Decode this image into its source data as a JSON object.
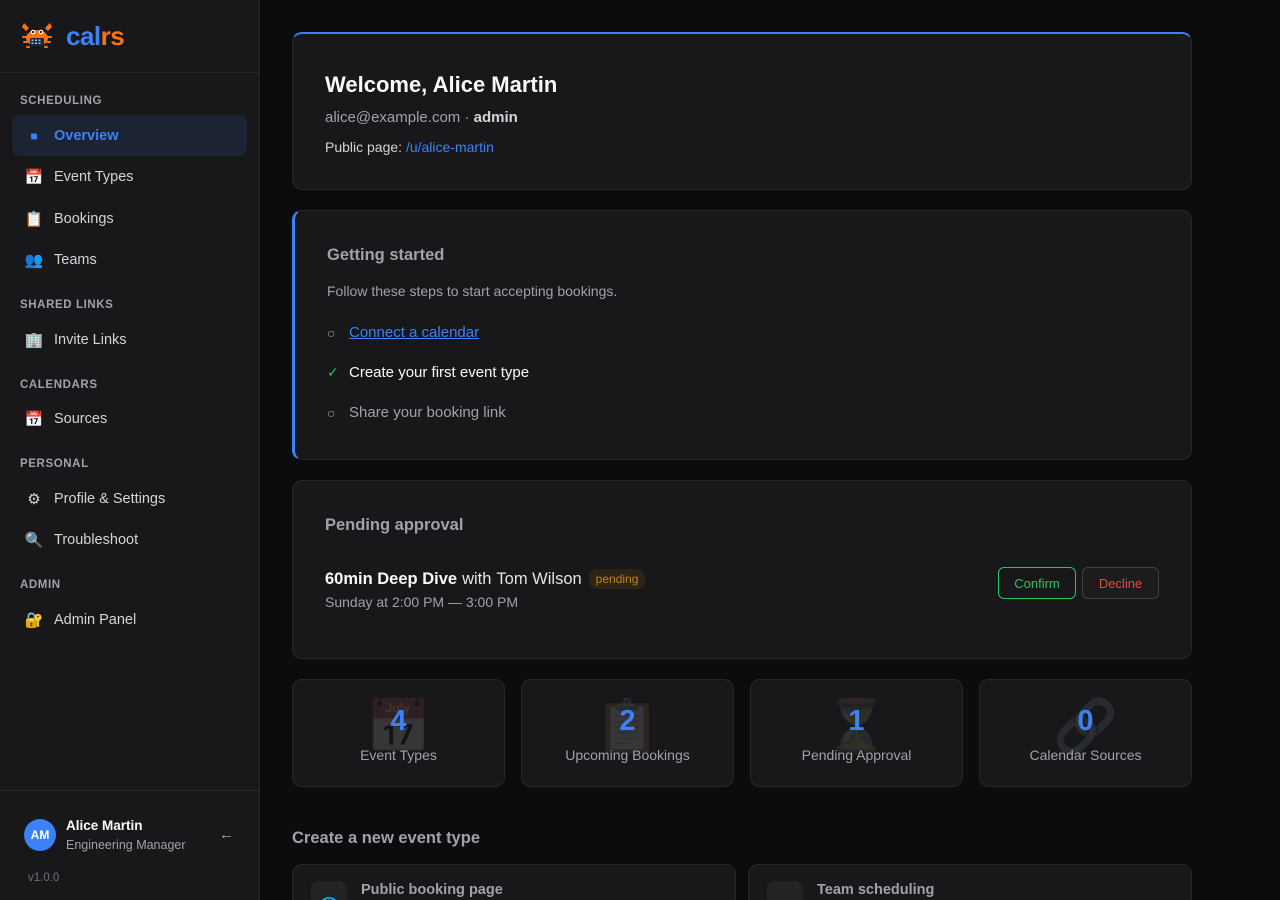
{
  "brand": {
    "name_part1": "cal",
    "name_part2": "rs"
  },
  "colors": {
    "accent": "#3b82f6",
    "brand_orange": "#f97316",
    "success": "#22c55e",
    "danger": "#ef4444",
    "warning": "#c2851a"
  },
  "sidebar": {
    "sections": [
      {
        "title": "Scheduling"
      },
      {
        "title": "Shared Links"
      },
      {
        "title": "Calendars"
      },
      {
        "title": "Personal"
      },
      {
        "title": "Admin"
      }
    ],
    "items": [
      {
        "label": "Overview",
        "icon": "square-icon",
        "glyph": "■",
        "active": true
      },
      {
        "label": "Event Types",
        "icon": "calendar-icon",
        "glyph": "📅"
      },
      {
        "label": "Bookings",
        "icon": "clipboard-icon",
        "glyph": "📋"
      },
      {
        "label": "Teams",
        "icon": "people-icon",
        "glyph": "👥"
      },
      {
        "label": "Invite Links",
        "icon": "building-icon",
        "glyph": "🏢"
      },
      {
        "label": "Sources",
        "icon": "calendar-icon",
        "glyph": "📅"
      },
      {
        "label": "Profile & Settings",
        "icon": "gear-icon",
        "glyph": "⚙"
      },
      {
        "label": "Troubleshoot",
        "icon": "magnifier-icon",
        "glyph": "🔍"
      },
      {
        "label": "Admin Panel",
        "icon": "lock-key-icon",
        "glyph": "🔐"
      }
    ],
    "user": {
      "initials": "AM",
      "name": "Alice Martin",
      "role": "Engineering Manager",
      "logout_glyph": "←"
    },
    "version": "v1.0.0"
  },
  "welcome": {
    "title": "Welcome, Alice Martin",
    "email": "alice@example.com",
    "separator": " · ",
    "role": "admin",
    "public_label": "Public page: ",
    "public_link": "/u/alice-martin"
  },
  "getting_started": {
    "title": "Getting started",
    "description": "Follow these steps to start accepting bookings.",
    "steps": [
      {
        "mark": "○",
        "label": "Connect a calendar",
        "done": false
      },
      {
        "mark": "✓",
        "label": "Create your first event type",
        "done": true
      },
      {
        "mark": "○",
        "label": "Share your booking link",
        "done": false
      }
    ]
  },
  "pending": {
    "title": "Pending approval",
    "event_name": "60min Deep Dive",
    "with_text": "with",
    "attendee": "Tom Wilson",
    "badge": "pending",
    "time": "Sunday at 2:00 PM — 3:00 PM",
    "confirm_label": "Confirm",
    "decline_label": "Decline"
  },
  "stats": [
    {
      "value": "4",
      "label": "Event Types",
      "icon": "calendar-icon",
      "glyph": "📅"
    },
    {
      "value": "2",
      "label": "Upcoming Bookings",
      "icon": "clipboard-icon",
      "glyph": "📋"
    },
    {
      "value": "1",
      "label": "Pending Approval",
      "icon": "hourglass-icon",
      "glyph": "⏳"
    },
    {
      "value": "0",
      "label": "Calendar Sources",
      "icon": "link-icon",
      "glyph": "🔗"
    }
  ],
  "create": {
    "title": "Create a new event type",
    "options": [
      {
        "title": "Public booking page",
        "icon": "globe-icon",
        "glyph": "🌐"
      },
      {
        "title": "Team scheduling",
        "icon": "people-icon",
        "glyph": "👥"
      }
    ]
  }
}
